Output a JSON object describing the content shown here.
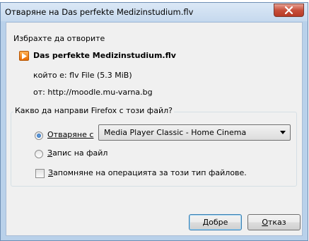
{
  "window": {
    "title": "Отваряне на Das perfekte Medizinstudium.flv"
  },
  "dialog": {
    "heading": "Избрахте да отворите",
    "file_name": "Das perfekte Medizinstudium.flv",
    "type_label": "който е:",
    "type_value": "flv File (5.3 MiB)",
    "from_label": "от:",
    "from_value": "http://moodle.mu-varna.bg",
    "action_group_label": "Какво да направи Firefox с този файл?",
    "open_with": {
      "label_hotkey": "О",
      "label_rest": "тваряне с",
      "checked": true,
      "app": "Media Player Classic - Home Cinema"
    },
    "save_file": {
      "label_hotkey": "З",
      "label_rest": "апис на файл",
      "checked": false
    },
    "remember": {
      "label_hotkey": "З",
      "label_rest": "апомняне на операцията за този тип файлове.",
      "checked": false
    }
  },
  "buttons": {
    "ok": {
      "label_hotkey": "Д",
      "label_rest": "обре"
    },
    "cancel": {
      "label_hotkey": "О",
      "label_rest": "тказ"
    }
  },
  "icons": {
    "file_type": "media-file-icon",
    "close": "close-icon",
    "dropdown": "chevron-down-icon"
  },
  "colors": {
    "window_frame": "#b9d1ea",
    "dialog_background": "#f0f0f0",
    "close_button": "#c74f3b",
    "file_icon": "#e86b00"
  }
}
